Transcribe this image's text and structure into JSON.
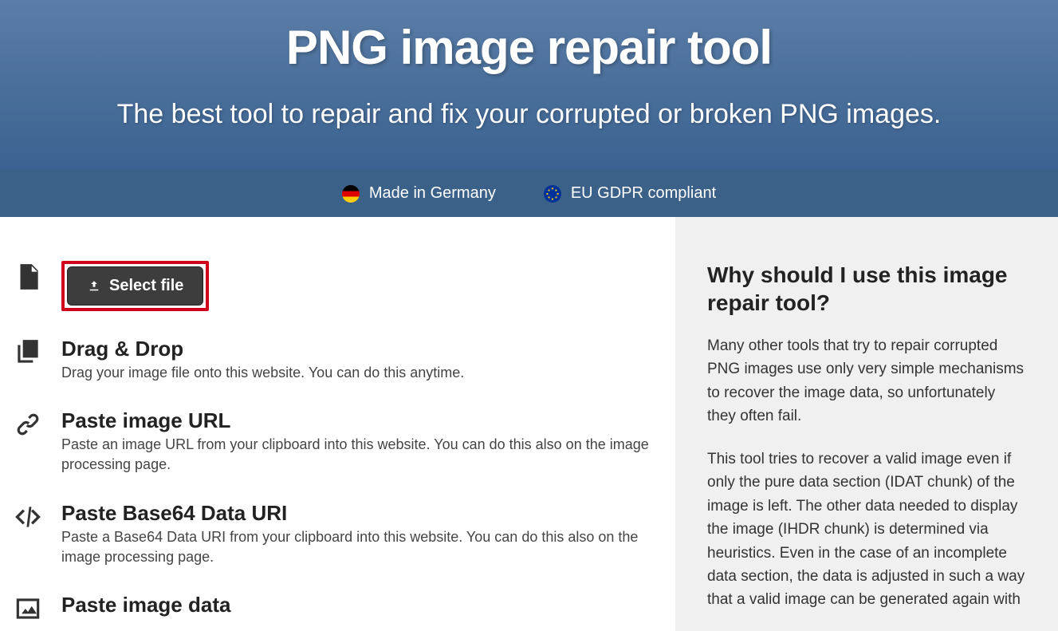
{
  "hero": {
    "title": "PNG image repair tool",
    "subtitle": "The best tool to repair and fix your corrupted or broken PNG images."
  },
  "badges": {
    "made_in": "Made in Germany",
    "gdpr": "EU GDPR compliant"
  },
  "select_file_label": "Select file",
  "methods": {
    "drag": {
      "title": "Drag & Drop",
      "desc": "Drag your image file onto this website. You can do this anytime."
    },
    "url": {
      "title": "Paste image URL",
      "desc": "Paste an image URL from your clipboard into this website. You can do this also on the image processing page."
    },
    "b64": {
      "title": "Paste Base64 Data URI",
      "desc": "Paste a Base64 Data URI from your clipboard into this website. You can do this also on the image processing page."
    },
    "data": {
      "title": "Paste image data"
    }
  },
  "sidebar": {
    "heading": "Why should I use this image repair tool?",
    "p1": "Many other tools that try to repair corrupted PNG images use only very simple mechanisms to recover the image data, so unfortunately they often fail.",
    "p2": "This tool tries to recover a valid image even if only the pure data section (IDAT chunk) of the image is left. The other data needed to display the image (IHDR chunk) is determined via heuristics. Even in the case of an incomplete data section, the data is adjusted in such a way that a valid image can be generated again with"
  }
}
